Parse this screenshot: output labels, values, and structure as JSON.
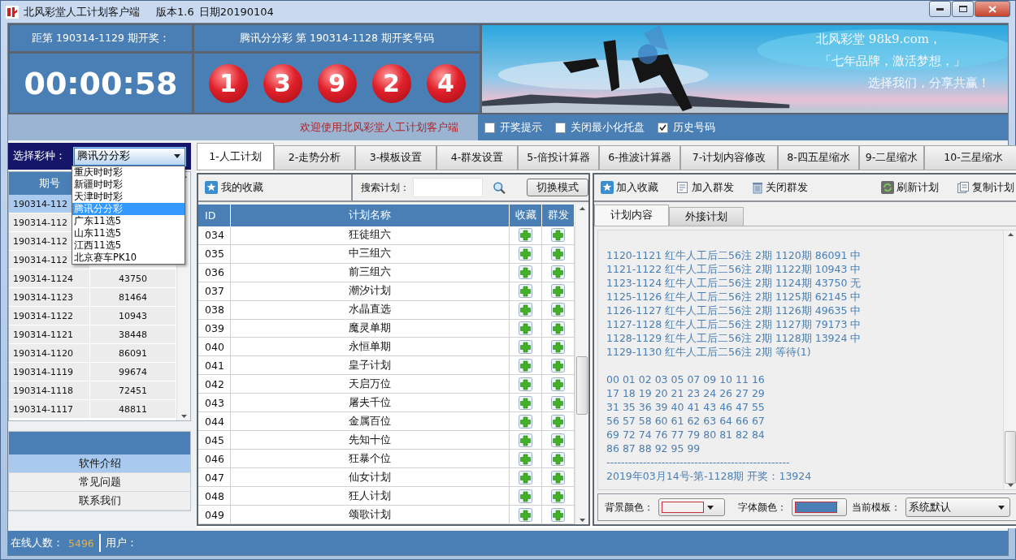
{
  "window": {
    "title": "北风彩堂人工计划客户端",
    "version": "版本1.6",
    "build_date": "日期20190104"
  },
  "countdown": {
    "label": "距第 190314-1129 期开奖：",
    "time": "00:00:58"
  },
  "draw": {
    "label": "腾讯分分彩 第 190314-1128 期开奖号码",
    "balls": [
      "1",
      "3",
      "9",
      "2",
      "4"
    ]
  },
  "banner": {
    "kind": "picture",
    "lines": [
      "北风彩堂 98k9.com，",
      "「七年品牌，激活梦想，」",
      "选择我们，分享共赢！"
    ]
  },
  "welcome": "欢迎使用北风彩堂人工计划客户端",
  "options": [
    {
      "label": "开奖提示",
      "checked": false
    },
    {
      "label": "关闭最小化托盘",
      "checked": false
    },
    {
      "label": "历史号码",
      "checked": true
    }
  ],
  "lottery_select": {
    "label": "选择彩种：",
    "value": "腾讯分分彩",
    "expanded": true,
    "options": [
      {
        "label": "重庆时时彩",
        "selected": false
      },
      {
        "label": "新疆时时彩",
        "selected": false
      },
      {
        "label": "天津时时彩",
        "selected": false
      },
      {
        "label": "腾讯分分彩",
        "selected": true
      },
      {
        "label": "广东11选5",
        "selected": false
      },
      {
        "label": "山东11选5",
        "selected": false
      },
      {
        "label": "江西11选5",
        "selected": false
      },
      {
        "label": "北京赛车PK10",
        "selected": false
      }
    ]
  },
  "tabs": [
    {
      "label": "1-人工计划",
      "selected": true
    },
    {
      "label": "2-走势分析",
      "selected": false
    },
    {
      "label": "3-模板设置",
      "selected": false
    },
    {
      "label": "4-群发设置",
      "selected": false
    },
    {
      "label": "5-倍投计算器",
      "selected": false
    },
    {
      "label": "6-推波计算器",
      "selected": false
    },
    {
      "label": "7-计划内容修改",
      "selected": false
    },
    {
      "label": "8-四五星缩水",
      "selected": false
    },
    {
      "label": "9-二星缩水",
      "selected": false
    },
    {
      "label": "10-三星缩水",
      "selected": false
    }
  ],
  "history": {
    "columns": [
      "期号"
    ],
    "rows": [
      {
        "cells": [
          "190314-112"
        ],
        "selected": true
      },
      {
        "cells": [
          "190314-112"
        ],
        "selected": false
      },
      {
        "cells": [
          "190314-112"
        ],
        "selected": false
      },
      {
        "cells": [
          "190314-112"
        ],
        "selected": false
      },
      {
        "cells": [
          "190314-1124",
          "43750"
        ],
        "selected": false
      },
      {
        "cells": [
          "190314-1123",
          "81464"
        ],
        "selected": false
      },
      {
        "cells": [
          "190314-1122",
          "10943"
        ],
        "selected": false
      },
      {
        "cells": [
          "190314-1121",
          "38448"
        ],
        "selected": false
      },
      {
        "cells": [
          "190314-1120",
          "86091"
        ],
        "selected": false
      },
      {
        "cells": [
          "190314-1119",
          "99674"
        ],
        "selected": false
      },
      {
        "cells": [
          "190314-1118",
          "72451"
        ],
        "selected": false
      },
      {
        "cells": [
          "190314-1117",
          "48811"
        ],
        "selected": false
      }
    ]
  },
  "side_menu": [
    {
      "label": "软件介绍",
      "selected": true
    },
    {
      "label": "常见问题",
      "selected": false
    },
    {
      "label": "联系我们",
      "selected": false
    }
  ],
  "plans": {
    "favorites": "我的收藏",
    "search_label": "搜索计划：",
    "switch_button": "切换模式",
    "columns": [
      "ID",
      "计划名称",
      "收藏",
      "群发"
    ],
    "rows": [
      {
        "id": "034",
        "name": "狂徒组六"
      },
      {
        "id": "035",
        "name": "中三组六"
      },
      {
        "id": "036",
        "name": "前三组六"
      },
      {
        "id": "037",
        "name": "潮汐计划"
      },
      {
        "id": "038",
        "name": "水晶直选"
      },
      {
        "id": "039",
        "name": "魔灵单期"
      },
      {
        "id": "040",
        "name": "永恒单期"
      },
      {
        "id": "041",
        "name": "皇子计划"
      },
      {
        "id": "042",
        "name": "天启万位"
      },
      {
        "id": "043",
        "name": "屠夫千位"
      },
      {
        "id": "044",
        "name": "金属百位"
      },
      {
        "id": "045",
        "name": "先知十位"
      },
      {
        "id": "046",
        "name": "狂暴个位"
      },
      {
        "id": "047",
        "name": "仙女计划"
      },
      {
        "id": "048",
        "name": "狂人计划"
      },
      {
        "id": "049",
        "name": "颂歌计划"
      }
    ]
  },
  "plan_actions": [
    {
      "label": "加入收藏",
      "kind": "favorite"
    },
    {
      "label": "加入群发",
      "kind": "group"
    },
    {
      "label": "关闭群发",
      "kind": "trash"
    },
    {
      "label": "刷新计划",
      "kind": "refresh"
    },
    {
      "label": "复制计划",
      "kind": "copy"
    }
  ],
  "content_tabs": [
    {
      "label": "计划内容",
      "selected": true
    },
    {
      "label": "外接计划",
      "selected": false
    }
  ],
  "plan_content": {
    "history_lines": [
      "1120-1121 红牛人工后二56注 2期 1120期 86091 中",
      "1121-1122 红牛人工后二56注 2期 1122期 10943 中",
      "1123-1124 红牛人工后二56注 2期 1124期 43750 无",
      "1125-1126 红牛人工后二56注 2期 1125期 62145 中",
      "1126-1127 红牛人工后二56注 2期 1126期 49635 中",
      "1127-1128 红牛人工后二56注 2期 1127期 79173 中",
      "1128-1129 红牛人工后二56注 2期 1128期 13924 中",
      "1129-1130 红牛人工后二56注 2期 等待(1)"
    ],
    "number_lines": [
      "00 01 02 03 05 07 09 10 11 16",
      "17 18 19 20 21 23 24 26 27 29",
      "31 35 36 39 40 41 43 46 47 55",
      "56 57 58 60 61 62 63 64 66 67",
      "69 72 74 76 77 79 80 81 82 84",
      "86 87 88 92 95 99"
    ],
    "separator": "--------------------------------------------------",
    "draw_line": "2019年03月14号-第-1128期 开奖：13924"
  },
  "appearance": {
    "background_label": "背景颜色：",
    "font_label": "字体颜色：",
    "template_label": "当前模板：",
    "template": "系统默认"
  },
  "status_bar": {
    "online_label": "在线人数：",
    "online_count": "5496",
    "user_label": "用户："
  }
}
